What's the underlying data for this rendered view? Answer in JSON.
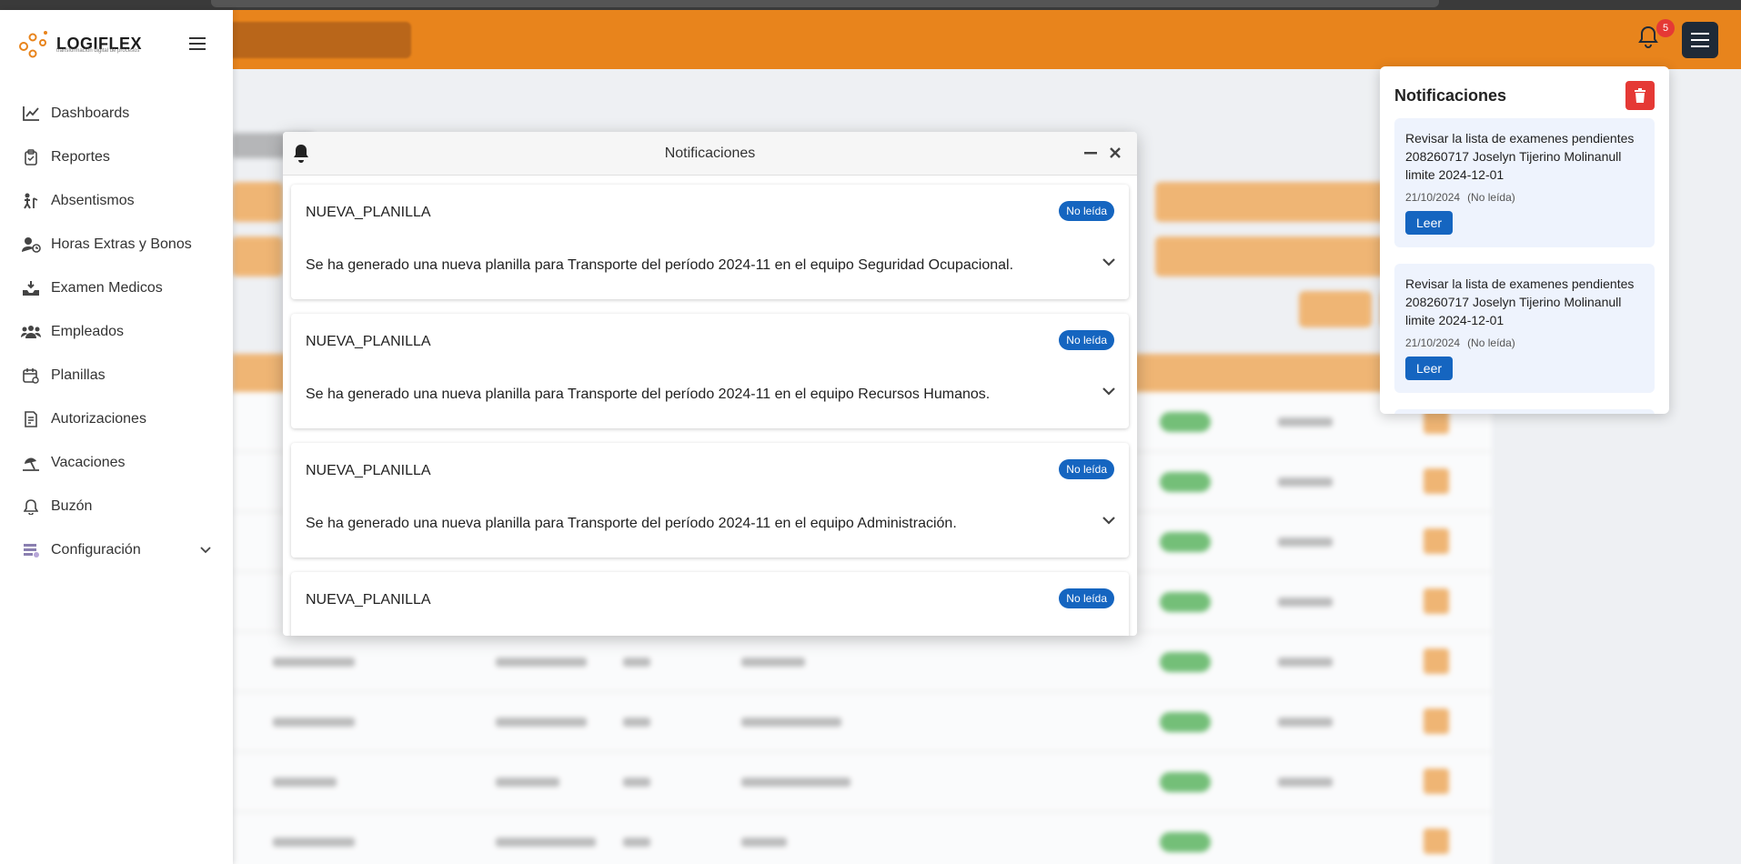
{
  "header": {
    "notification_count": "5",
    "colors": {
      "accent": "#e8841c",
      "dark": "#1f2a37",
      "badge": "#e53935",
      "primary": "#1565c0"
    }
  },
  "sidebar": {
    "logo_text": "LOGIFLEX",
    "logo_subtitle": "transformación digital de procesos",
    "items": [
      {
        "label": "Dashboards",
        "icon": "chart-line-icon"
      },
      {
        "label": "Reportes",
        "icon": "clipboard-icon"
      },
      {
        "label": "Absentismos",
        "icon": "person-walking-icon"
      },
      {
        "label": "Horas Extras y Bonos",
        "icon": "user-clock-icon"
      },
      {
        "label": "Examen Medicos",
        "icon": "medical-icon"
      },
      {
        "label": "Empleados",
        "icon": "people-icon"
      },
      {
        "label": "Planillas",
        "icon": "calendar-icon"
      },
      {
        "label": "Autorizaciones",
        "icon": "document-check-icon"
      },
      {
        "label": "Vacaciones",
        "icon": "umbrella-beach-icon"
      },
      {
        "label": "Buzón",
        "icon": "bell-icon"
      },
      {
        "label": "Configuración",
        "icon": "settings-icon"
      }
    ]
  },
  "modal": {
    "title": "Notificaciones",
    "cards": [
      {
        "title": "NUEVA_PLANILLA",
        "badge": "No leída",
        "message": "Se ha generado una nueva planilla para Transporte del período 2024-11 en el equipo Seguridad Ocupacional."
      },
      {
        "title": "NUEVA_PLANILLA",
        "badge": "No leída",
        "message": "Se ha generado una nueva planilla para Transporte del período 2024-11 en el equipo Recursos Humanos."
      },
      {
        "title": "NUEVA_PLANILLA",
        "badge": "No leída",
        "message": "Se ha generado una nueva planilla para Transporte del período 2024-11 en el equipo Administración."
      },
      {
        "title": "NUEVA_PLANILLA",
        "badge": "No leída",
        "message": ""
      }
    ]
  },
  "dropdown": {
    "title": "Notificaciones",
    "items": [
      {
        "text": "Revisar la lista de examenes pendientes 208260717 Joselyn Tijerino Molinanull limite 2024-12-01",
        "date": "21/10/2024",
        "status": "(No leída)",
        "button": "Leer"
      },
      {
        "text": "Revisar la lista de examenes pendientes 208260717 Joselyn Tijerino Molinanull limite 2024-12-01",
        "date": "21/10/2024",
        "status": "(No leída)",
        "button": "Leer"
      }
    ]
  }
}
